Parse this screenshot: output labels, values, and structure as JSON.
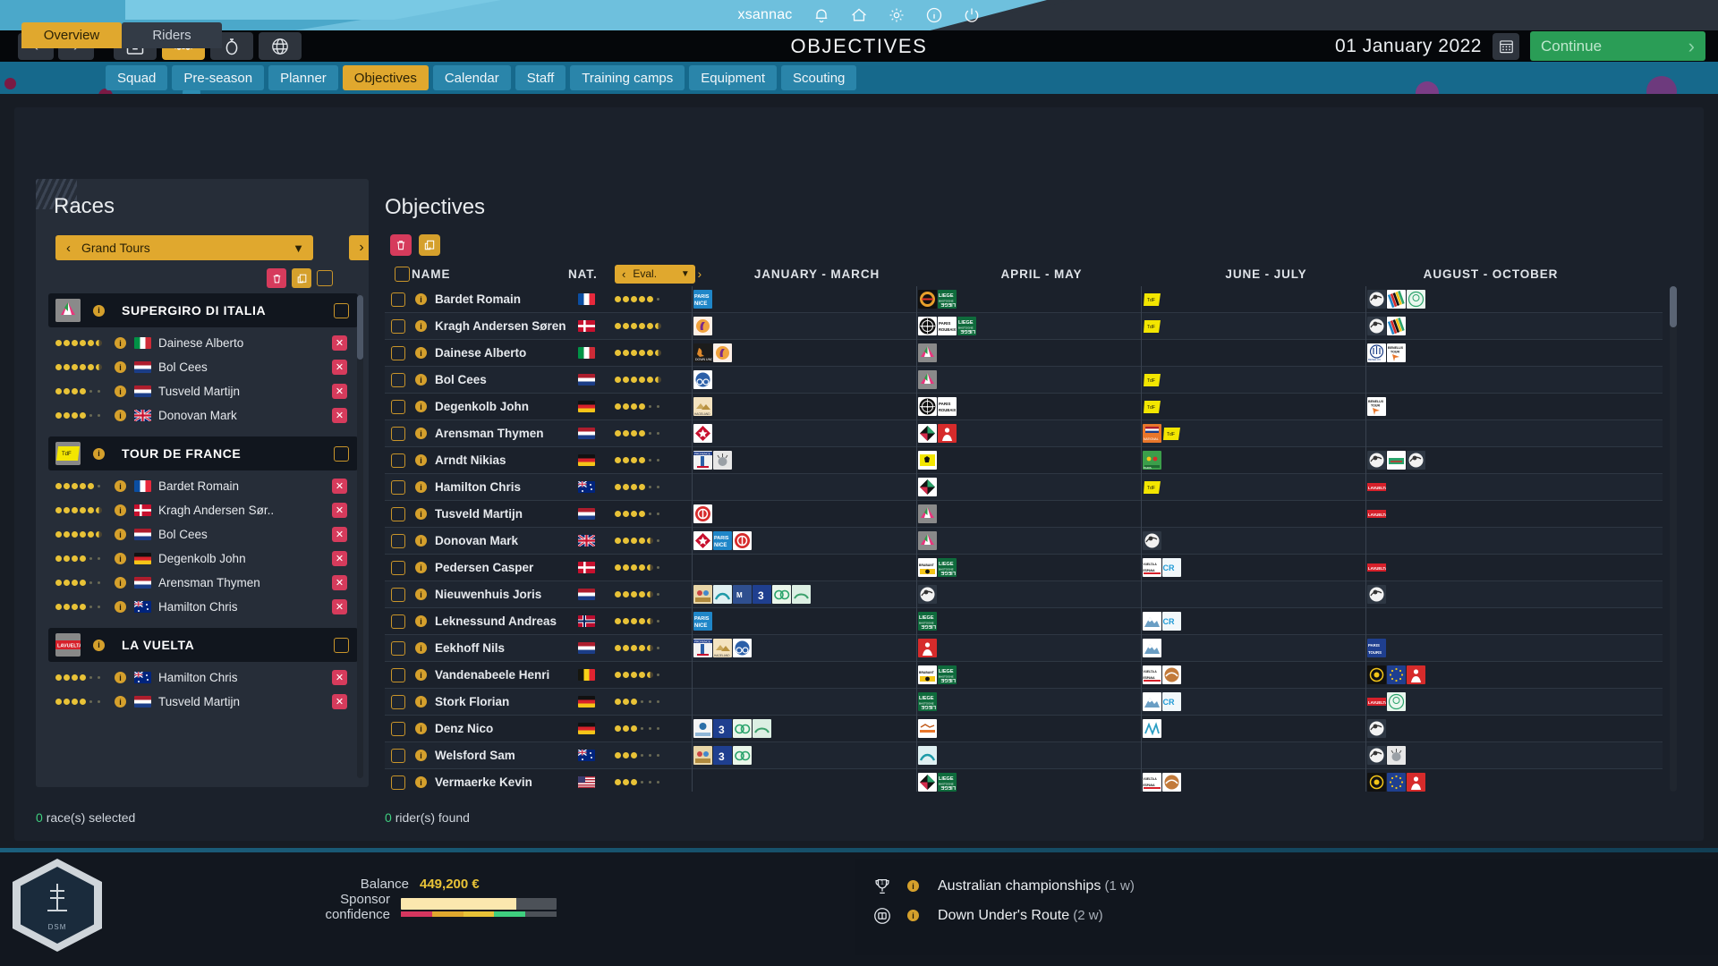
{
  "banner": {
    "username": "xsannac",
    "icons": [
      "bell-icon",
      "home-icon",
      "gear-icon",
      "info-icon",
      "power-icon"
    ]
  },
  "header": {
    "title": "OBJECTIVES",
    "date": "01 January 2022",
    "continue_label": "Continue",
    "nav": {
      "back": "‹",
      "forward": "›"
    },
    "mode_buttons": [
      "briefcase-icon",
      "riders-icon",
      "stopwatch-icon",
      "globe-icon"
    ],
    "active_mode_index": 1,
    "calendar_icon": "calendar-icon"
  },
  "tabs": [
    {
      "label": "Squad",
      "active": false
    },
    {
      "label": "Pre-season",
      "active": false
    },
    {
      "label": "Planner",
      "active": false
    },
    {
      "label": "Objectives",
      "active": true
    },
    {
      "label": "Calendar",
      "active": false
    },
    {
      "label": "Staff",
      "active": false
    },
    {
      "label": "Training camps",
      "active": false
    },
    {
      "label": "Equipment",
      "active": false
    },
    {
      "label": "Scouting",
      "active": false
    }
  ],
  "subtabs": [
    {
      "label": "Overview",
      "active": true
    },
    {
      "label": "Riders",
      "active": false
    }
  ],
  "races_panel": {
    "title": "Races",
    "filter_value": "Grand Tours",
    "tools": [
      "delete-icon",
      "duplicate-icon",
      "select-all-checkbox"
    ],
    "groups": [
      {
        "name": "SUPERGIRO DI ITALIA",
        "logo": "supergiro-logo",
        "riders": [
          {
            "name": "Dainese Alberto",
            "nat": "it",
            "stars": 5,
            "half": true
          },
          {
            "name": "Bol Cees",
            "nat": "nl",
            "stars": 5,
            "half": true
          },
          {
            "name": "Tusveld Martijn",
            "nat": "nl",
            "stars": 4,
            "half": false
          },
          {
            "name": "Donovan Mark",
            "nat": "gb",
            "stars": 4,
            "half": false
          }
        ]
      },
      {
        "name": "TOUR DE FRANCE",
        "logo": "tdf-logo",
        "riders": [
          {
            "name": "Bardet Romain",
            "nat": "fr",
            "stars": 5,
            "half": false
          },
          {
            "name": "Kragh Andersen Sør..",
            "nat": "dk",
            "stars": 5,
            "half": true
          },
          {
            "name": "Bol Cees",
            "nat": "nl",
            "stars": 5,
            "half": true
          },
          {
            "name": "Degenkolb John",
            "nat": "de",
            "stars": 4,
            "half": false
          },
          {
            "name": "Arensman Thymen",
            "nat": "nl",
            "stars": 4,
            "half": false
          },
          {
            "name": "Hamilton Chris",
            "nat": "au",
            "stars": 4,
            "half": false
          }
        ]
      },
      {
        "name": "LA VUELTA",
        "logo": "lavuelta-logo",
        "riders": [
          {
            "name": "Hamilton Chris",
            "nat": "au",
            "stars": 4,
            "half": false
          },
          {
            "name": "Tusveld Martijn",
            "nat": "nl",
            "stars": 4,
            "half": false
          }
        ]
      }
    ],
    "status": {
      "count": "0",
      "text": "race(s) selected"
    }
  },
  "objectives_panel": {
    "title": "Objectives",
    "tools": [
      "delete-icon",
      "duplicate-icon"
    ],
    "columns": {
      "name": "NAME",
      "nat": "NAT.",
      "eval": "Eval.",
      "p1": "JANUARY - MARCH",
      "p2": "APRIL - MAY",
      "p3": "JUNE - JULY",
      "p4": "AUGUST - OCTOBER"
    },
    "status": {
      "count": "0",
      "text": "rider(s) found"
    },
    "rows": [
      {
        "name": "Bardet Romain",
        "nat": "fr",
        "stars": 5,
        "half": false,
        "p1": [
          "paris-nice"
        ],
        "p2": [
          "tour-flanders",
          "liege"
        ],
        "p3": [
          "tdf"
        ],
        "p4": [
          "worlds",
          "rainbow",
          "olympics"
        ]
      },
      {
        "name": "Kragh Andersen Søren",
        "nat": "dk",
        "stars": 5,
        "half": true,
        "p1": [
          "sanremo"
        ],
        "p2": [
          "roubaix-globe",
          "paris-roubaix",
          "liege"
        ],
        "p3": [
          "tdf"
        ],
        "p4": [
          "worlds",
          "rainbow"
        ]
      },
      {
        "name": "Dainese Alberto",
        "nat": "it",
        "stars": 5,
        "half": true,
        "p1": [
          "down-under",
          "sanremo"
        ],
        "p2": [
          "supergiro"
        ],
        "p3": [],
        "p4": [
          "benelux-dark",
          "benelux-tour"
        ]
      },
      {
        "name": "Bol Cees",
        "nat": "nl",
        "stars": 5,
        "half": true,
        "p1": [
          "bike-blue"
        ],
        "p2": [
          "supergiro"
        ],
        "p3": [
          "tdf"
        ],
        "p4": []
      },
      {
        "name": "Degenkolb John",
        "nat": "de",
        "stars": 4,
        "half": false,
        "p1": [
          "hageland"
        ],
        "p2": [
          "roubaix-globe",
          "paris-roubaix"
        ],
        "p3": [
          "tdf"
        ],
        "p4": [
          "benelux-tour"
        ]
      },
      {
        "name": "Arensman Thymen",
        "nat": "nl",
        "stars": 4,
        "half": false,
        "p1": [
          "red-diamond"
        ],
        "p2": [
          "flanders-black",
          "red-race"
        ],
        "p3": [
          "nat-itt",
          "tdf"
        ],
        "p4": []
      },
      {
        "name": "Arndt Nikias",
        "nat": "de",
        "stars": 4,
        "half": false,
        "p1": [
          "provence",
          "grey-race"
        ],
        "p2": [
          "vlaanderen"
        ],
        "p3": [
          "green-race"
        ],
        "p4": [
          "worlds",
          "green-flag",
          "worlds"
        ]
      },
      {
        "name": "Hamilton Chris",
        "nat": "au",
        "stars": 4,
        "half": false,
        "p1": [],
        "p2": [
          "flanders-black"
        ],
        "p3": [
          "tdf"
        ],
        "p4": [
          "lavuelta"
        ]
      },
      {
        "name": "Tusveld Martijn",
        "nat": "nl",
        "stars": 4,
        "half": false,
        "p1": [
          "red-circle"
        ],
        "p2": [
          "supergiro"
        ],
        "p3": [],
        "p4": [
          "lavuelta"
        ]
      },
      {
        "name": "Donovan Mark",
        "nat": "gb",
        "stars": 4,
        "half": true,
        "p1": [
          "red-diamond",
          "paris-nice",
          "red-circle"
        ],
        "p2": [
          "supergiro"
        ],
        "p3": [
          "worlds"
        ],
        "p4": []
      },
      {
        "name": "Pedersen Casper",
        "nat": "dk",
        "stars": 4,
        "half": true,
        "p1": [],
        "p2": [
          "brabant",
          "liege"
        ],
        "p3": [
          "vuelta-sm",
          "cro-race"
        ],
        "p4": [
          "lavuelta"
        ]
      },
      {
        "name": "Nieuwenhuis Joris",
        "nat": "nl",
        "stars": 4,
        "half": true,
        "p1": [
          "cyclocross",
          "teal-race",
          "blue-sm",
          "blue-3",
          "cx-green",
          "cx-light"
        ],
        "p2": [
          "worlds"
        ],
        "p3": [],
        "p4": [
          "worlds"
        ]
      },
      {
        "name": "Leknessund Andreas",
        "nat": "no",
        "stars": 4,
        "half": true,
        "p1": [
          "paris-nice"
        ],
        "p2": [
          "liege"
        ],
        "p3": [
          "mountain",
          "cro-race"
        ],
        "p4": []
      },
      {
        "name": "Eekhoff Nils",
        "nat": "nl",
        "stars": 4,
        "half": true,
        "p1": [
          "provence",
          "hageland",
          "bike-blue"
        ],
        "p2": [
          "red-race"
        ],
        "p3": [
          "mountain"
        ],
        "p4": [
          "paris-tours"
        ]
      },
      {
        "name": "Vandenabeele Henri",
        "nat": "be",
        "stars": 4,
        "half": true,
        "p1": [],
        "p2": [
          "brabant",
          "liege"
        ],
        "p3": [
          "vuelta-sm",
          "brown-race"
        ],
        "p4": [
          "olympic-dark",
          "euro-blue",
          "red-race"
        ]
      },
      {
        "name": "Stork Florian",
        "nat": "de",
        "stars": 3,
        "half": false,
        "p1": [],
        "p2": [
          "liege"
        ],
        "p3": [
          "mountain",
          "cro-race"
        ],
        "p4": [
          "lavuelta",
          "olympics"
        ]
      },
      {
        "name": "Denz Nico",
        "nat": "de",
        "stars": 3,
        "half": false,
        "p1": [
          "cx-white",
          "blue-3",
          "cx-green",
          "cx-light"
        ],
        "p2": [
          "orange-race"
        ],
        "p3": [
          "white-race"
        ],
        "p4": [
          "worlds"
        ]
      },
      {
        "name": "Welsford Sam",
        "nat": "au",
        "stars": 3,
        "half": false,
        "p1": [
          "cyclocross",
          "blue-3",
          "cx-green"
        ],
        "p2": [
          "teal-race"
        ],
        "p3": [],
        "p4": [
          "worlds",
          "grey-race"
        ]
      },
      {
        "name": "Vermaerke Kevin",
        "nat": "us",
        "stars": 3,
        "half": false,
        "p1": [],
        "p2": [
          "flanders-black",
          "liege"
        ],
        "p3": [
          "vuelta-sm",
          "brown-race"
        ],
        "p4": [
          "olympic-dark",
          "euro-blue",
          "red-race"
        ]
      }
    ]
  },
  "bottom": {
    "balance_label": "Balance",
    "balance_value": "449,200 €",
    "confidence_label": "Sponsor confidence",
    "confidence_percent": 74,
    "news": [
      {
        "icon": "trophy-icon",
        "title": "Australian championships",
        "when": "(1 w)"
      },
      {
        "icon": "route-icon",
        "title": "Down Under's Route",
        "when": "(2 w)"
      }
    ]
  },
  "colors": {
    "accent": "#e0a82e",
    "danger": "#d63b5c",
    "success": "#2a9d56",
    "tabbar": "#16698c"
  }
}
